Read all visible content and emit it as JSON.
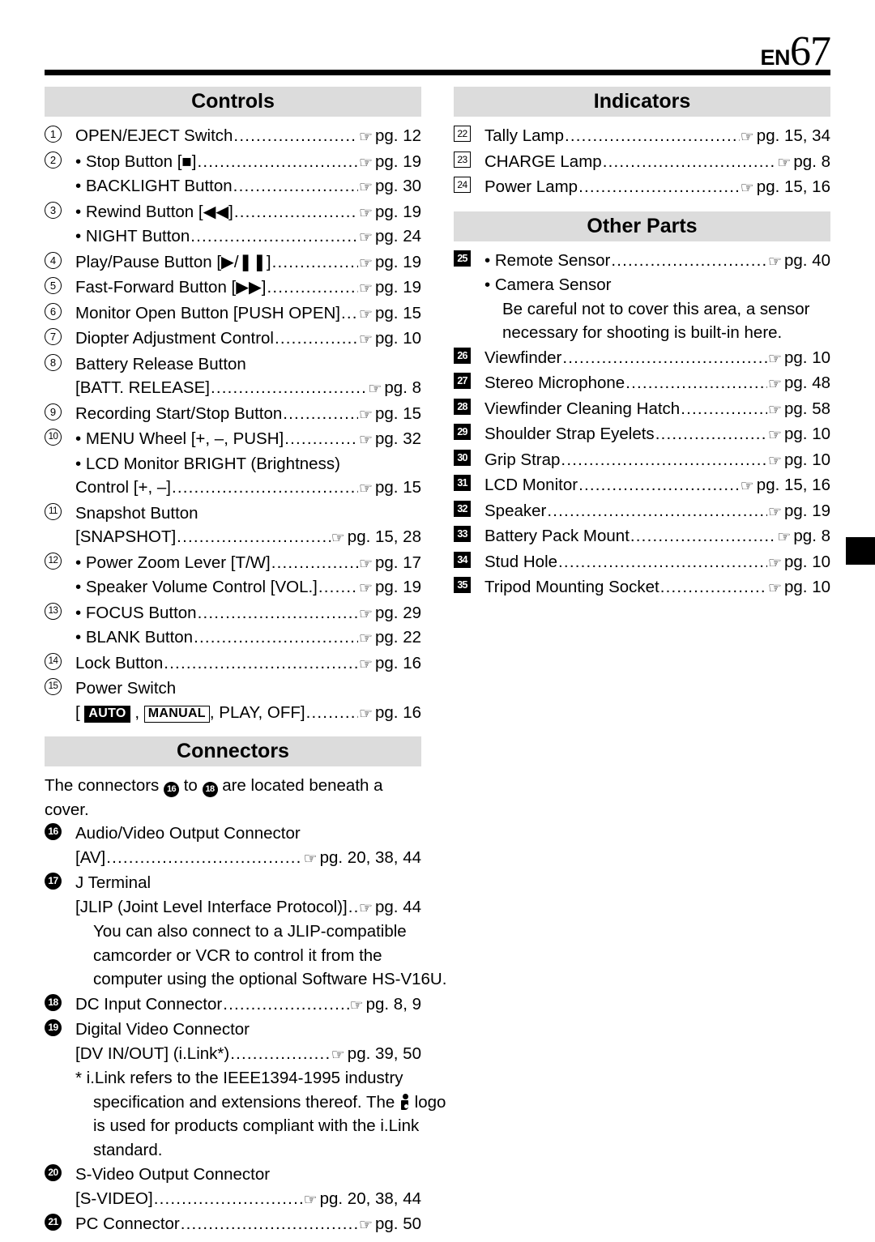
{
  "header": {
    "language_code": "EN",
    "page_number": "67"
  },
  "icons": {
    "reference_hand": "☞"
  },
  "left_column": {
    "sections": [
      {
        "title": "Controls",
        "entries": [
          {
            "marker": "1",
            "marker_style": "circle",
            "lines": [
              {
                "text": "OPEN/EJECT Switch",
                "page": "pg. 12"
              }
            ]
          },
          {
            "marker": "2",
            "marker_style": "circle",
            "lines": [
              {
                "text": "• Stop Button [■]",
                "page": "pg. 19"
              },
              {
                "text": "• BACKLIGHT Button",
                "page": "pg. 30"
              }
            ]
          },
          {
            "marker": "3",
            "marker_style": "circle",
            "lines": [
              {
                "text": "• Rewind Button [◀◀]",
                "page": "pg. 19"
              },
              {
                "text": "• NIGHT Button",
                "page": "pg. 24"
              }
            ]
          },
          {
            "marker": "4",
            "marker_style": "circle",
            "lines": [
              {
                "text": "Play/Pause Button [▶/❚❚]",
                "page": "pg. 19"
              }
            ]
          },
          {
            "marker": "5",
            "marker_style": "circle",
            "lines": [
              {
                "text": "Fast-Forward Button [▶▶]",
                "page": "pg. 19"
              }
            ]
          },
          {
            "marker": "6",
            "marker_style": "circle",
            "lines": [
              {
                "text": "Monitor Open Button [PUSH OPEN]",
                "page": "pg. 15"
              }
            ]
          },
          {
            "marker": "7",
            "marker_style": "circle",
            "lines": [
              {
                "text": "Diopter Adjustment Control",
                "page": "pg. 10"
              }
            ]
          },
          {
            "marker": "8",
            "marker_style": "circle",
            "lines": [
              {
                "text": "Battery Release Button",
                "page": ""
              },
              {
                "text": "[BATT. RELEASE]",
                "page": "pg. 8"
              }
            ]
          },
          {
            "marker": "9",
            "marker_style": "circle",
            "lines": [
              {
                "text": "Recording Start/Stop Button",
                "page": "pg. 15"
              }
            ]
          },
          {
            "marker": "10",
            "marker_style": "circle",
            "lines": [
              {
                "text": "• MENU Wheel [+, –, PUSH]",
                "page": "pg. 32"
              },
              {
                "text": "• LCD Monitor BRIGHT (Brightness)",
                "page": ""
              },
              {
                "text": "Control [+, –]",
                "page": "pg. 15"
              }
            ]
          },
          {
            "marker": "11",
            "marker_style": "circle",
            "lines": [
              {
                "text": "Snapshot Button",
                "page": ""
              },
              {
                "text": "[SNAPSHOT]",
                "page": "pg. 15, 28"
              }
            ]
          },
          {
            "marker": "12",
            "marker_style": "circle",
            "lines": [
              {
                "text": "• Power Zoom Lever [T/W]",
                "page": "pg. 17"
              },
              {
                "text": "• Speaker Volume Control [VOL.]",
                "page": "pg. 19"
              }
            ]
          },
          {
            "marker": "13",
            "marker_style": "circle",
            "lines": [
              {
                "text": "• FOCUS Button",
                "page": "pg. 29"
              },
              {
                "text": "• BLANK Button",
                "page": "pg. 22"
              }
            ]
          },
          {
            "marker": "14",
            "marker_style": "circle",
            "lines": [
              {
                "text": "Lock Button",
                "page": "pg. 16"
              }
            ]
          },
          {
            "marker": "15",
            "marker_style": "circle",
            "lines": [
              {
                "text": "Power Switch",
                "page": ""
              }
            ],
            "power_switch": {
              "prefix": "[ ",
              "badge_auto": "AUTO",
              "separator1": " , ",
              "badge_manual": "MANUAL",
              "suffix": ", PLAY, OFF]",
              "page": "pg. 16"
            }
          }
        ]
      },
      {
        "title": "Connectors",
        "intro": {
          "part1": "The connectors ",
          "ref1": "16",
          "part2": " to ",
          "ref2": "18",
          "part3": " are located beneath a cover."
        },
        "entries": [
          {
            "marker": "16",
            "marker_style": "filled-circle",
            "lines": [
              {
                "text": "Audio/Video Output Connector",
                "page": ""
              },
              {
                "text": "[AV]",
                "page": "pg. 20, 38, 44"
              }
            ]
          },
          {
            "marker": "17",
            "marker_style": "filled-circle",
            "lines": [
              {
                "text": "J Terminal",
                "page": ""
              },
              {
                "text": "[JLIP (Joint Level Interface Protocol)]",
                "page": "pg. 44"
              }
            ],
            "notes": [
              "You can also connect to a JLIP-compatible",
              "camcorder or VCR to control it from the",
              "computer using the optional Software HS-V16U."
            ]
          },
          {
            "marker": "18",
            "marker_style": "filled-circle",
            "lines": [
              {
                "text": "DC Input Connector",
                "page": "pg. 8, 9"
              }
            ]
          },
          {
            "marker": "19",
            "marker_style": "filled-circle",
            "lines": [
              {
                "text": "Digital Video Connector",
                "page": ""
              },
              {
                "text": "[DV IN/OUT] (i.Link*)",
                "page": "pg. 39, 50"
              }
            ],
            "footnote": {
              "line1": "* i.Link refers to the IEEE1394-1995 industry",
              "line2a": "specification and extensions thereof. The ",
              "line2b": " logo",
              "line3": "is used for products compliant with the i.Link",
              "line4": "standard."
            }
          },
          {
            "marker": "20",
            "marker_style": "filled-circle",
            "lines": [
              {
                "text": "S-Video Output Connector",
                "page": ""
              },
              {
                "text": "[S-VIDEO]",
                "page": "pg. 20, 38, 44"
              }
            ]
          },
          {
            "marker": "21",
            "marker_style": "filled-circle",
            "lines": [
              {
                "text": "PC Connector",
                "page": "pg. 50"
              }
            ]
          }
        ]
      }
    ]
  },
  "right_column": {
    "sections": [
      {
        "title": "Indicators",
        "entries": [
          {
            "marker": "22",
            "marker_style": "square",
            "lines": [
              {
                "text": "Tally Lamp",
                "page": "pg. 15, 34"
              }
            ]
          },
          {
            "marker": "23",
            "marker_style": "square",
            "lines": [
              {
                "text": "CHARGE Lamp",
                "page": "pg. 8"
              }
            ]
          },
          {
            "marker": "24",
            "marker_style": "square",
            "lines": [
              {
                "text": "Power Lamp",
                "page": "pg. 15, 16"
              }
            ]
          }
        ]
      },
      {
        "title": "Other Parts",
        "entries": [
          {
            "marker": "25",
            "marker_style": "filled-square",
            "lines": [
              {
                "text": "• Remote Sensor",
                "page": "pg. 40"
              },
              {
                "text": "• Camera Sensor",
                "page": ""
              }
            ],
            "notes": [
              "Be careful not to cover this area, a sensor",
              "necessary for shooting is built-in here."
            ]
          },
          {
            "marker": "26",
            "marker_style": "filled-square",
            "lines": [
              {
                "text": "Viewfinder",
                "page": "pg. 10"
              }
            ]
          },
          {
            "marker": "27",
            "marker_style": "filled-square",
            "lines": [
              {
                "text": "Stereo Microphone",
                "page": "pg. 48"
              }
            ]
          },
          {
            "marker": "28",
            "marker_style": "filled-square",
            "lines": [
              {
                "text": "Viewfinder Cleaning Hatch",
                "page": "pg. 58"
              }
            ]
          },
          {
            "marker": "29",
            "marker_style": "filled-square",
            "lines": [
              {
                "text": "Shoulder Strap Eyelets",
                "page": "pg. 10"
              }
            ]
          },
          {
            "marker": "30",
            "marker_style": "filled-square",
            "lines": [
              {
                "text": "Grip Strap",
                "page": "pg. 10"
              }
            ]
          },
          {
            "marker": "31",
            "marker_style": "filled-square",
            "lines": [
              {
                "text": "LCD Monitor",
                "page": "pg. 15, 16"
              }
            ]
          },
          {
            "marker": "32",
            "marker_style": "filled-square",
            "lines": [
              {
                "text": "Speaker",
                "page": "pg. 19"
              }
            ]
          },
          {
            "marker": "33",
            "marker_style": "filled-square",
            "lines": [
              {
                "text": "Battery Pack Mount",
                "page": "pg. 8"
              }
            ]
          },
          {
            "marker": "34",
            "marker_style": "filled-square",
            "lines": [
              {
                "text": "Stud Hole",
                "page": "pg. 10"
              }
            ]
          },
          {
            "marker": "35",
            "marker_style": "filled-square",
            "lines": [
              {
                "text": "Tripod Mounting Socket",
                "page": "pg. 10"
              }
            ]
          }
        ]
      }
    ]
  }
}
